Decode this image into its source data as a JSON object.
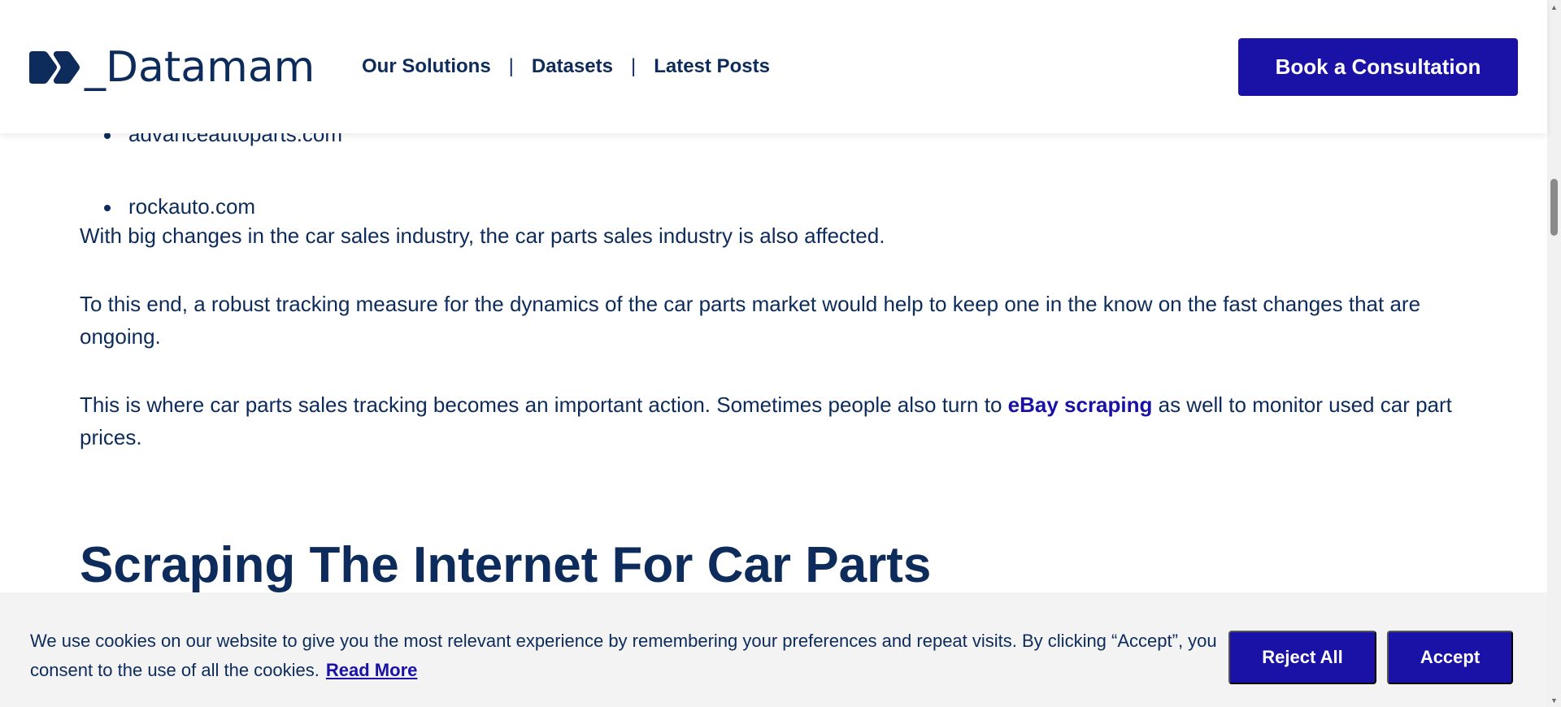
{
  "header": {
    "logo_text": "_Datamam",
    "nav": [
      {
        "label": "Our Solutions"
      },
      {
        "label": "Datasets"
      },
      {
        "label": "Latest Posts"
      }
    ],
    "separator": "|",
    "cta_label": "Book a Consultation"
  },
  "article": {
    "bullets": [
      "advanceautoparts.com",
      "rockauto.com"
    ],
    "p1": "With big changes in the car sales industry, the car parts sales industry is also affected.",
    "p2": "To this end, a robust tracking measure for the dynamics of the car parts market would help to keep one in the know on the fast changes that are ongoing.",
    "p3_before": "This is where car parts sales tracking becomes an important action. Sometimes people also turn to ",
    "p3_link": "eBay scraping",
    "p3_after": " as well to monitor used car part prices.",
    "heading": "Scraping The Internet For Car Parts"
  },
  "cookie": {
    "text": "We use cookies on our website to give you the most relevant experience by remembering your preferences and repeat visits. By clicking “Accept”, you consent to the use of all the cookies.",
    "read_more": "Read More",
    "reject_label": "Reject All",
    "accept_label": "Accept"
  },
  "colors": {
    "brand_primary": "#1a12a6",
    "text_navy": "#0d2b5b",
    "cookie_bg": "#f3f3f3"
  },
  "icons": {
    "logo_mark": "double-chevron-logo-icon",
    "scroll_up": "scroll-up-arrow-icon",
    "scroll_down": "scroll-down-arrow-icon"
  }
}
